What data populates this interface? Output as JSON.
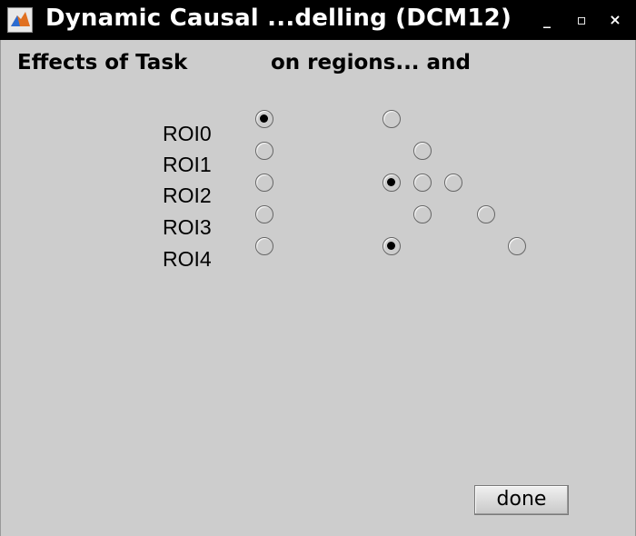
{
  "window": {
    "title": "Dynamic Causal ...delling (DCM12)",
    "buttons": {
      "minimize": "_",
      "maximize": "▫",
      "close": "×"
    }
  },
  "panel": {
    "heading_left": "Effects of Task",
    "heading_right": "on regions... and"
  },
  "regions": [
    "ROI0",
    "ROI1",
    "ROI2",
    "ROI3",
    "ROI4"
  ],
  "matrix": {
    "rows": [
      {
        "region": "ROI0",
        "region_effect": true,
        "connections": [
          false,
          null,
          null,
          null,
          null
        ]
      },
      {
        "region": "ROI1",
        "region_effect": false,
        "connections": [
          null,
          false,
          null,
          null,
          null
        ]
      },
      {
        "region": "ROI2",
        "region_effect": false,
        "connections": [
          true,
          false,
          false,
          null,
          null
        ]
      },
      {
        "region": "ROI3",
        "region_effect": false,
        "connections": [
          null,
          false,
          null,
          false,
          null
        ]
      },
      {
        "region": "ROI4",
        "region_effect": false,
        "connections": [
          true,
          null,
          null,
          null,
          false
        ]
      }
    ]
  },
  "done_label": "done",
  "colors": {
    "background": "#cdcdcd",
    "titlebar": "#000000",
    "selected_dot": "#000000"
  }
}
